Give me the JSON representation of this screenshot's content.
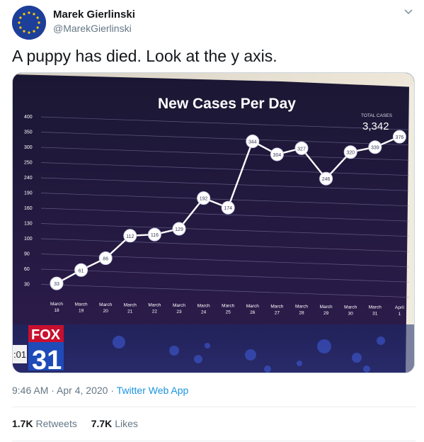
{
  "tweet": {
    "author_name": "Marek Gierlinski",
    "author_handle": "@MarekGierlinski",
    "text": "A puppy has died. Look at the y axis.",
    "time": "9:46 AM",
    "date": "Apr 4, 2020",
    "sep1": " · ",
    "sep2": " · ",
    "app": "Twitter Web App",
    "retweets_count": "1.7K",
    "retweets_label": "Retweets",
    "likes_count": "7.7K",
    "likes_label": "Likes"
  },
  "icons": {
    "caret": "chevron-down-icon",
    "avatar": "eu-flag-avatar"
  },
  "colors": {
    "link": "#1b95e0",
    "secondary": "#657786",
    "chart_bg": "#24173a",
    "fox_red": "#c8102e"
  },
  "broadcast": {
    "logo_text": "FOX",
    "channel": "31",
    "clock_fragment": ":01"
  },
  "chart_data": {
    "type": "line",
    "title": "New Cases Per Day",
    "total_label": "TOTAL CASES",
    "total_value": "3,342",
    "y_ticks": [
      "400",
      "350",
      "300",
      "250",
      "240",
      "190",
      "160",
      "130",
      "100",
      "90",
      "60",
      "30"
    ],
    "x": [
      {
        "m": "March",
        "d": "18"
      },
      {
        "m": "March",
        "d": "19"
      },
      {
        "m": "March",
        "d": "20"
      },
      {
        "m": "March",
        "d": "21"
      },
      {
        "m": "March",
        "d": "22"
      },
      {
        "m": "March",
        "d": "23"
      },
      {
        "m": "March",
        "d": "24"
      },
      {
        "m": "March",
        "d": "25"
      },
      {
        "m": "March",
        "d": "26"
      },
      {
        "m": "March",
        "d": "27"
      },
      {
        "m": "March",
        "d": "28"
      },
      {
        "m": "March",
        "d": "29"
      },
      {
        "m": "March",
        "d": "30"
      },
      {
        "m": "March",
        "d": "31"
      },
      {
        "m": "April",
        "d": "1"
      }
    ],
    "values": [
      33,
      61,
      86,
      112,
      116,
      129,
      192,
      174,
      344,
      304,
      327,
      246,
      320,
      339,
      376
    ],
    "labels": [
      "33",
      "61",
      "86",
      "112",
      "116",
      "129",
      "192",
      "174",
      "344",
      "304",
      "327",
      "246",
      "320",
      "339",
      "376"
    ]
  }
}
